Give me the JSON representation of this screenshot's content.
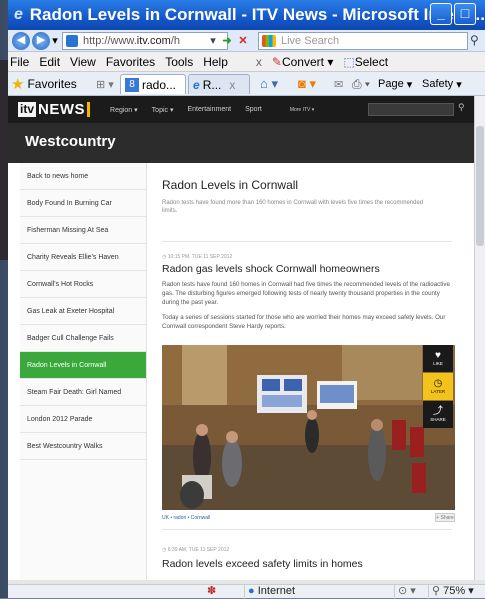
{
  "window": {
    "title": "Radon Levels in Cornwall - ITV News - Microsoft Intern...",
    "minimize_glyph": "_",
    "maximize_glyph": "□"
  },
  "addressbar": {
    "url_prefix": "http://www.",
    "url_domain": "itv.com",
    "url_suffix": "/h",
    "search_placeholder": "Live Search"
  },
  "menubar": {
    "items": [
      "File",
      "Edit",
      "View",
      "Favorites",
      "Tools",
      "Help"
    ],
    "close_glyph": "x",
    "convert_label": "Convert",
    "select_label": "Select"
  },
  "favbar": {
    "favorites_label": "Favorites",
    "tab1_label": "rado...",
    "tab2_label": "R...",
    "page_label": "Page",
    "safety_label": "Safety"
  },
  "itv": {
    "logo_itv": "itv",
    "logo_news": "NEWS",
    "nav": [
      "Region ▾",
      "Topic ▾",
      "Entertainment",
      "Sport",
      "More ITV ▾"
    ],
    "region_title": "Westcountry"
  },
  "sidebar": {
    "items": [
      "Back to news home",
      "Body Found In Burning Car",
      "Fisherman Missing At Sea",
      "Charity Reveals Ellie's Haven",
      "Cornwall's Hot Rocks",
      "Gas Leak at Exeter Hospital",
      "Badger Cull Challenge Fails",
      "Radon Levels in Cornwall",
      "Steam Fair Death: Girl Named",
      "London 2012 Parade",
      "Best Westcountry Walks"
    ],
    "active_index": 7
  },
  "article": {
    "title": "Radon Levels in Cornwall",
    "summary": "Radon tests have found more than 160 homes in Cornwall with levels five times the recommended limits.",
    "story1": {
      "timestamp": "◷ 10:15 PM, TUE 11 SEP 2012",
      "headline": "Radon gas levels shock Cornwall homeowners",
      "para1": "Radon tests have found 160 homes in Cornwall had five times the recommended levels of the radioactive gas. The disturbing figures emerged following tests of nearly twenty thousand properties in the county during the past year.",
      "para2": "Today a series of sessions started for those who are worried their homes may exceed safety levels. Our Cornwall correspondent Steve Hardy reports."
    },
    "rail": {
      "like": "LIKE",
      "later": "LATER",
      "share": "SHARE"
    },
    "crumbs": "UK • radon • Cornwall",
    "share_btn": "+ Share",
    "story2": {
      "timestamp": "◷ 6:39 AM, TUE 11 SEP 2012",
      "headline": "Radon levels exceed safety limits in homes"
    }
  },
  "statusbar": {
    "zone": "Internet",
    "zoom": "75%"
  }
}
